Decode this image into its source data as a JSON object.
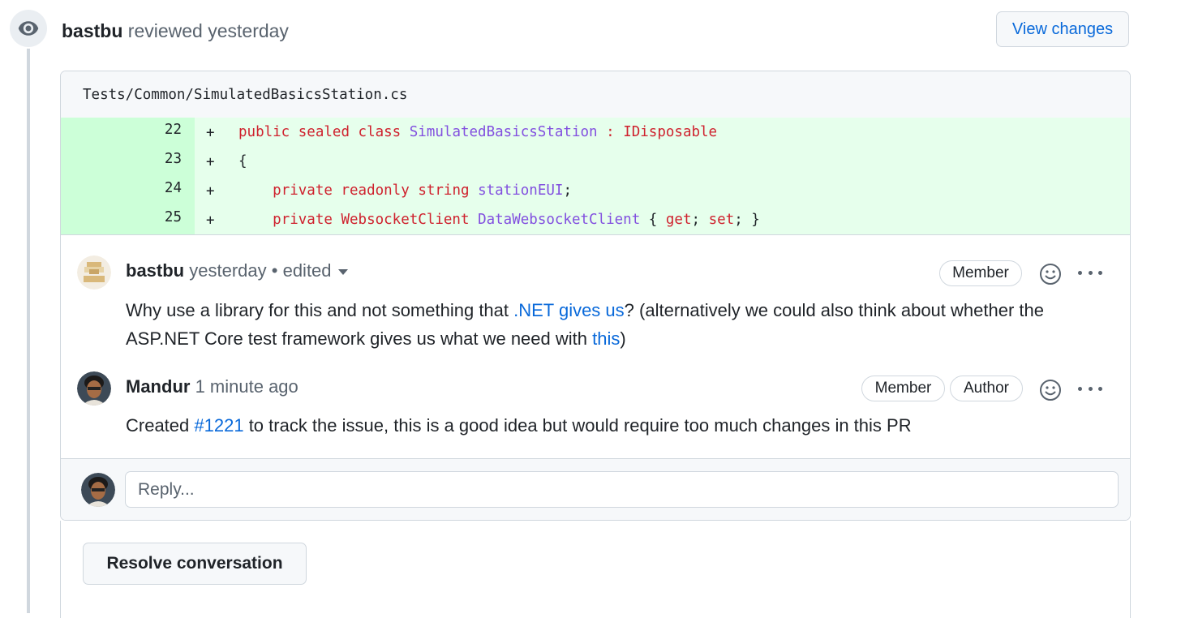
{
  "review": {
    "author": "bastbu",
    "action": "reviewed yesterday",
    "view_changes_label": "View changes"
  },
  "file": {
    "path": "Tests/Common/SimulatedBasicsStation.cs"
  },
  "diff": {
    "lines": [
      {
        "num": "22",
        "sign": "+"
      },
      {
        "num": "23",
        "sign": "+"
      },
      {
        "num": "24",
        "sign": "+"
      },
      {
        "num": "25",
        "sign": "+"
      }
    ],
    "tokens": {
      "l22_public": "public",
      "l22_sealed": "sealed",
      "l22_class": "class",
      "l22_name": "SimulatedBasicsStation",
      "l22_colon": ":",
      "l22_iface": "IDisposable",
      "l23_brace": "{",
      "l24_private": "private",
      "l24_readonly": "readonly",
      "l24_string": "string",
      "l24_field": "stationEUI",
      "l24_semi": ";",
      "l25_private": "private",
      "l25_type": "WebsocketClient",
      "l25_prop": "DataWebsocketClient",
      "l25_open": "{",
      "l25_get": "get",
      "l25_semi1": ";",
      "l25_set": "set",
      "l25_semi2": ";",
      "l25_close": "}"
    }
  },
  "comments": [
    {
      "author": "bastbu",
      "time": "yesterday",
      "edited": "• edited",
      "badges": [
        "Member"
      ],
      "body_1": "Why use a library for this and not something that ",
      "link_1": ".NET gives us",
      "body_2": "? (alternatively we could also think about whether the ASP.NET Core test framework gives us what we need with ",
      "link_2": "this",
      "body_3": ")"
    },
    {
      "author": "Mandur",
      "time": "1 minute ago",
      "badges": [
        "Member",
        "Author"
      ],
      "body_1": "Created ",
      "link_1": "#1221",
      "body_2": " to track the issue, this is a good idea but would require too much changes in this PR"
    }
  ],
  "reply": {
    "placeholder": "Reply..."
  },
  "resolve_label": "Resolve conversation",
  "colors": {
    "link": "#0969da",
    "added_bg": "#e6ffec",
    "added_num_bg": "#ccffd8",
    "keyword": "#cf222e",
    "type": "#8250df"
  }
}
